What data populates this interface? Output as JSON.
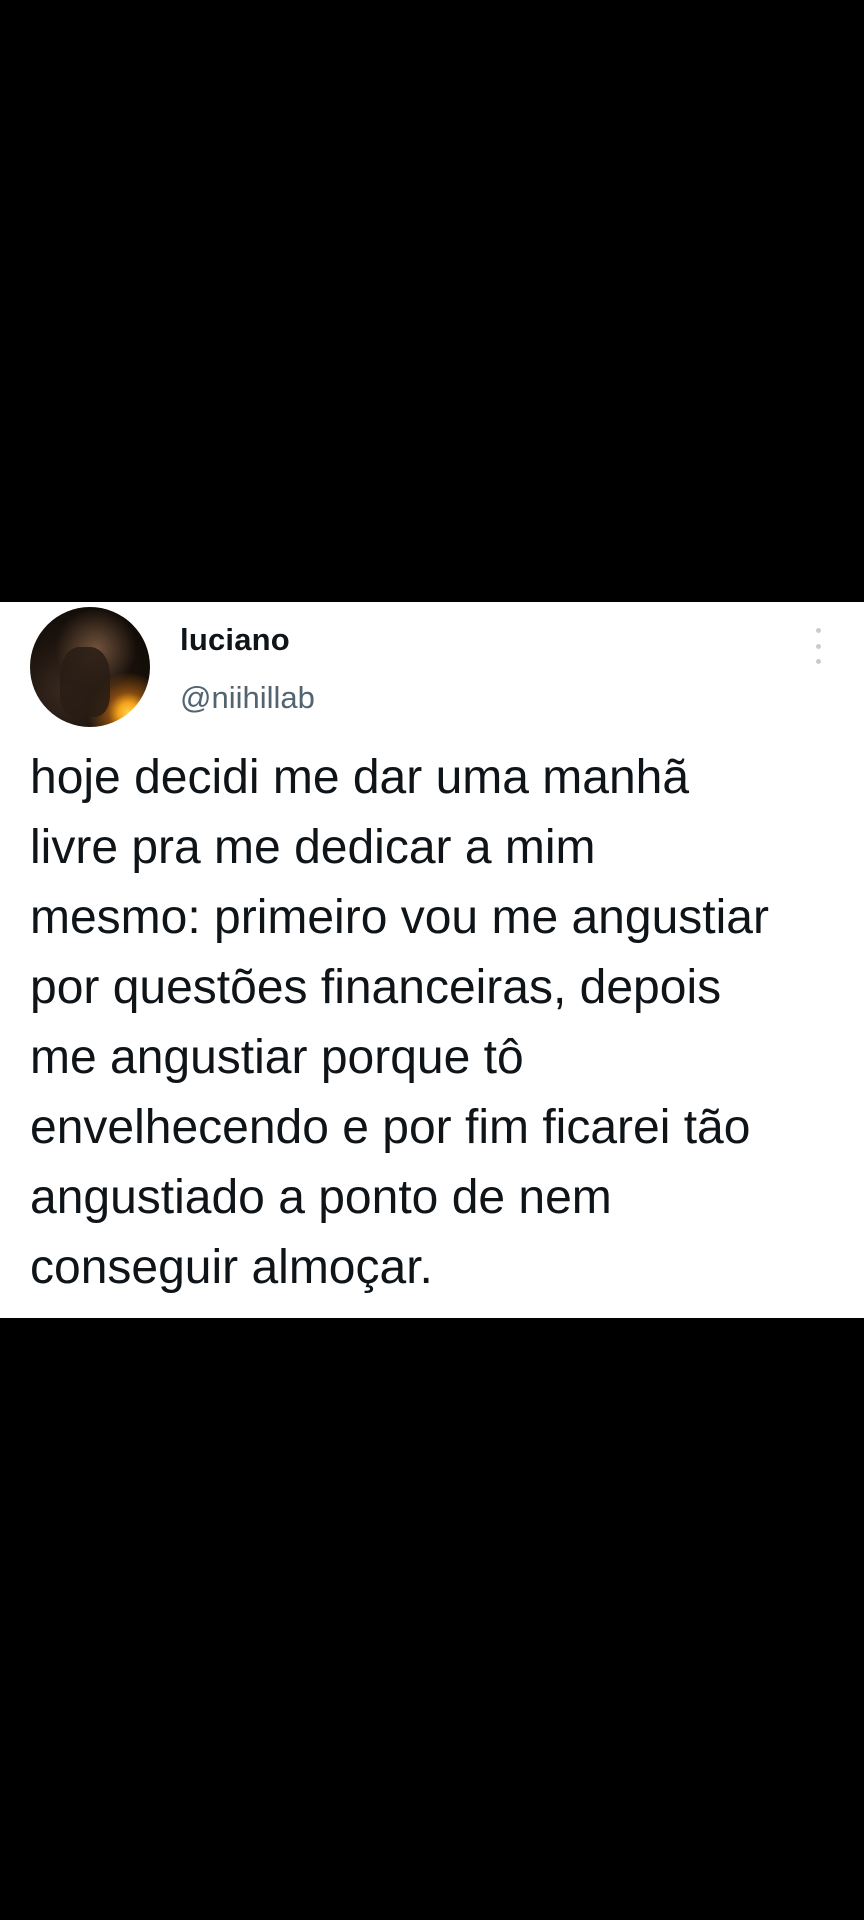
{
  "tweet": {
    "author_name": "luciano",
    "author_handle": "@niihillab",
    "text_lines": [
      "hoje decidi me dar uma manhã",
      "livre pra me dedicar a mim",
      "mesmo: primeiro vou me angustiar",
      "por questões financeiras, depois",
      "me angustiar porque tô",
      "envelhecendo e por fim ficarei tão",
      "angustiado a ponto de nem",
      "conseguir almoçar."
    ],
    "more_icon": "more-vertical-icon"
  },
  "colors": {
    "background": "#000000",
    "card": "#ffffff",
    "text_primary": "#0f1419",
    "text_secondary": "#536471",
    "menu_dots": "#c7ccd1"
  }
}
